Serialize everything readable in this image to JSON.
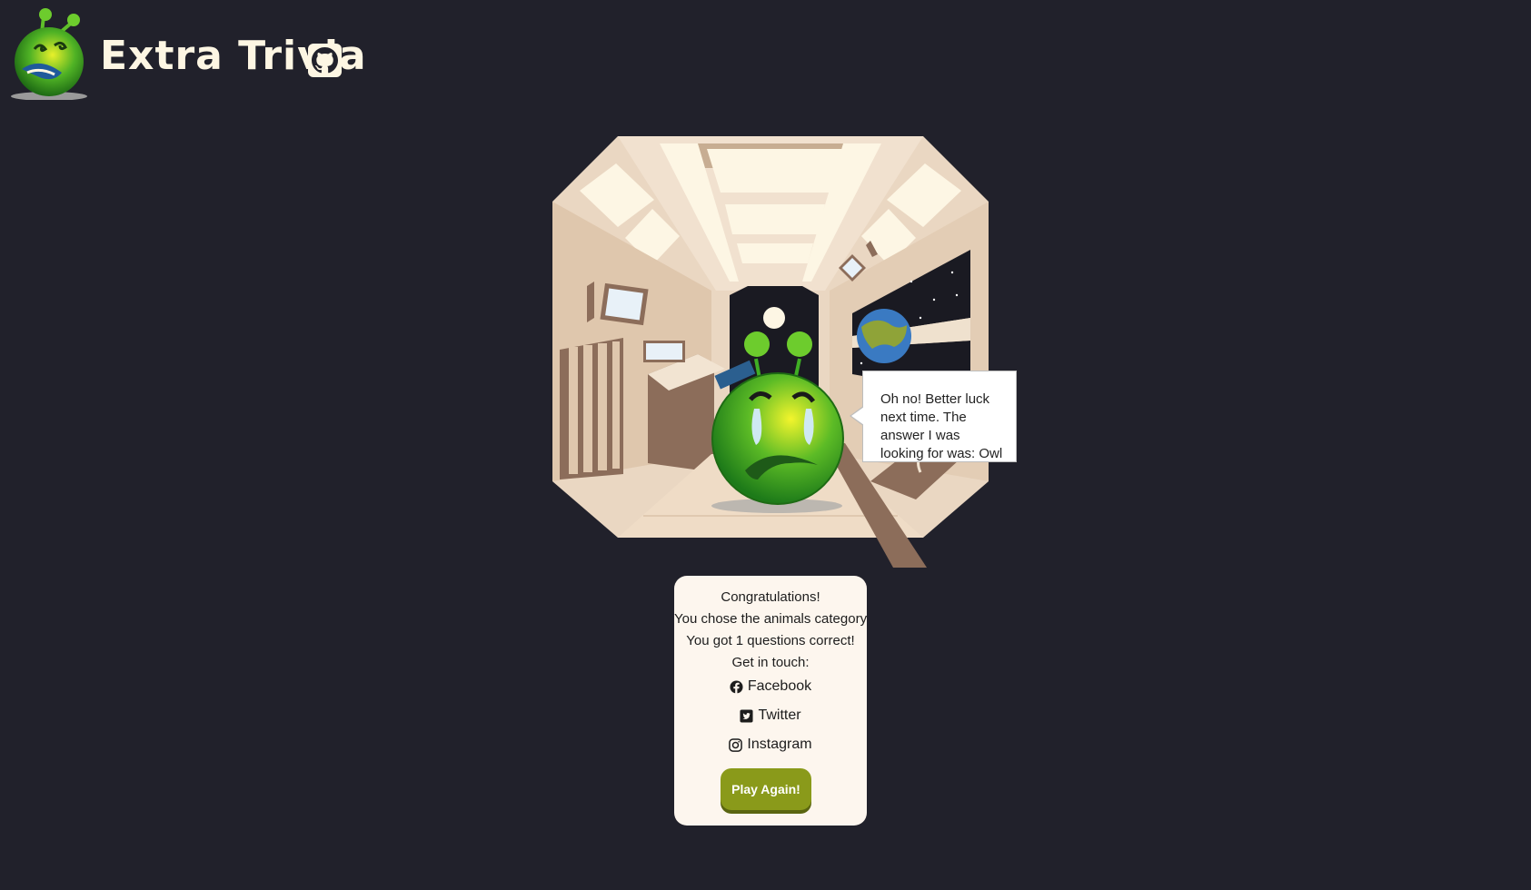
{
  "app": {
    "title": "Extra Trivia",
    "github_icon": "github-icon"
  },
  "scene": {
    "speech_bubble": "Oh no! Better luck next time. The answer I was looking for was: Owl"
  },
  "results": {
    "congrats": "Congratulations!",
    "category_line": "You chose the animals category",
    "score_line": "You got 1 questions correct!",
    "contact_heading": "Get in touch:",
    "links": [
      {
        "label": "Facebook",
        "icon": "facebook-icon"
      },
      {
        "label": "Twitter",
        "icon": "twitter-icon"
      },
      {
        "label": "Instagram",
        "icon": "instagram-icon"
      }
    ],
    "play_again": "Play Again!"
  },
  "colors": {
    "background": "#21212b",
    "brand_text": "#fdf6e3",
    "card": "#fdf6ee",
    "button": "#8a9a1a",
    "alien_green": "#3fae24"
  }
}
